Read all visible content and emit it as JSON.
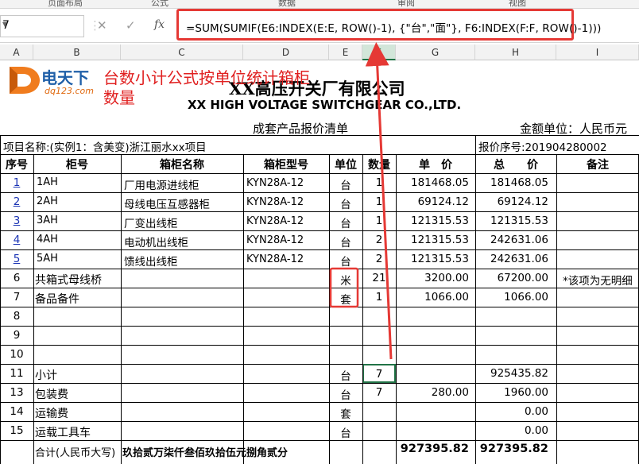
{
  "ribbon": {
    "tabs": [
      "页面布局",
      "公式",
      "数据",
      "审阅",
      "视图"
    ]
  },
  "formula_bar": {
    "name_box": "7",
    "cancel_icon": "✕",
    "enter_icon": "✓",
    "fx_label": "fx",
    "formula": "=SUM(SUMIF(E6:INDEX(E:E, ROW()-1), {\"台\",\"面\"}, F6:INDEX(F:F, ROW()-1)))"
  },
  "columns": [
    "A",
    "B",
    "C",
    "D",
    "E",
    "F",
    "G",
    "H",
    "I"
  ],
  "watermark": {
    "brand": "电天下",
    "url": "dq123.com"
  },
  "annotation": {
    "line1": "台数小计公式按单位统计箱柜",
    "line2": "数量"
  },
  "header": {
    "company_cn": "XX高压开关厂有限公司",
    "company_en": "XX HIGH VOLTAGE SWITCHGEAR CO.,LTD.",
    "subtitle": "成套产品报价清单",
    "currency": "金额单位：人民币元",
    "project": "项目名称:(实例1：含美变)浙江丽水xx项目",
    "quote_no": "报价序号:201904280002"
  },
  "table_headers": [
    "序号",
    "柜号",
    "箱柜名称",
    "箱柜型号",
    "单位",
    "数量",
    "单　价",
    "总　　价",
    "备注"
  ],
  "rows": [
    {
      "row": "5",
      "seq": "1",
      "cab": "1AH",
      "name": "厂用电源进线柜",
      "model": "KYN28A-12",
      "unit": "台",
      "qty": "1",
      "price": "181468.05",
      "total": "181468.05",
      "note": ""
    },
    {
      "row": "6",
      "seq": "2",
      "cab": "2AH",
      "name": "母线电压互感器柜",
      "model": "KYN28A-12",
      "unit": "台",
      "qty": "1",
      "price": "69124.12",
      "total": "69124.12",
      "note": ""
    },
    {
      "row": "7",
      "seq": "3",
      "cab": "3AH",
      "name": "厂变出线柜",
      "model": "KYN28A-12",
      "unit": "台",
      "qty": "1",
      "price": "121315.53",
      "total": "121315.53",
      "note": ""
    },
    {
      "row": "8",
      "seq": "4",
      "cab": "4AH",
      "name": "电动机出线柜",
      "model": "KYN28A-12",
      "unit": "台",
      "qty": "2",
      "price": "121315.53",
      "total": "242631.06",
      "note": ""
    },
    {
      "row": "9",
      "seq": "5",
      "cab": "5AH",
      "name": "馈线出线柜",
      "model": "KYN28A-12",
      "unit": "台",
      "qty": "2",
      "price": "121315.53",
      "total": "242631.06",
      "note": ""
    },
    {
      "row": "10",
      "seq": "6",
      "cab": "共箱式母线桥",
      "name": "",
      "model": "",
      "unit": "米",
      "qty": "21",
      "price": "3200.00",
      "total": "67200.00",
      "note": "*该项为无明细"
    },
    {
      "row": "11",
      "seq": "7",
      "cab": "备品备件",
      "name": "",
      "model": "",
      "unit": "套",
      "qty": "1",
      "price": "1066.00",
      "total": "1066.00",
      "note": ""
    },
    {
      "row": "12",
      "seq": "8",
      "cab": "",
      "name": "",
      "model": "",
      "unit": "",
      "qty": "",
      "price": "",
      "total": "",
      "note": ""
    },
    {
      "row": "13",
      "seq": "9",
      "cab": "",
      "name": "",
      "model": "",
      "unit": "",
      "qty": "",
      "price": "",
      "total": "",
      "note": ""
    },
    {
      "row": "14",
      "seq": "10",
      "cab": "",
      "name": "",
      "model": "",
      "unit": "",
      "qty": "",
      "price": "",
      "total": "",
      "note": ""
    },
    {
      "row": "15",
      "seq": "11",
      "cab": "小计",
      "name": "",
      "model": "",
      "unit": "台",
      "qty": "7",
      "price": "",
      "total": "925435.82",
      "note": ""
    },
    {
      "row": "16",
      "seq": "13",
      "cab": "包装费",
      "name": "",
      "model": "",
      "unit": "台",
      "qty": "7",
      "price": "280.00",
      "total": "1960.00",
      "note": ""
    },
    {
      "row": "17",
      "seq": "14",
      "cab": "运输费",
      "name": "",
      "model": "",
      "unit": "套",
      "qty": "",
      "price": "",
      "total": "0.00",
      "note": ""
    },
    {
      "row": "18",
      "seq": "15",
      "cab": "运载工具车",
      "name": "",
      "model": "",
      "unit": "台",
      "qty": "",
      "price": "",
      "total": "0.00",
      "note": ""
    }
  ],
  "total_row": {
    "label": "合计(人民币大写)",
    "amount_words": "玖拾贰万柒仟叁佰玖拾伍元捌角贰分",
    "price": "927395.82",
    "total": "927395.82"
  },
  "colors": {
    "annotation_red": "#e53935",
    "selection_green": "#217346",
    "link_blue": "#1a33b4"
  }
}
